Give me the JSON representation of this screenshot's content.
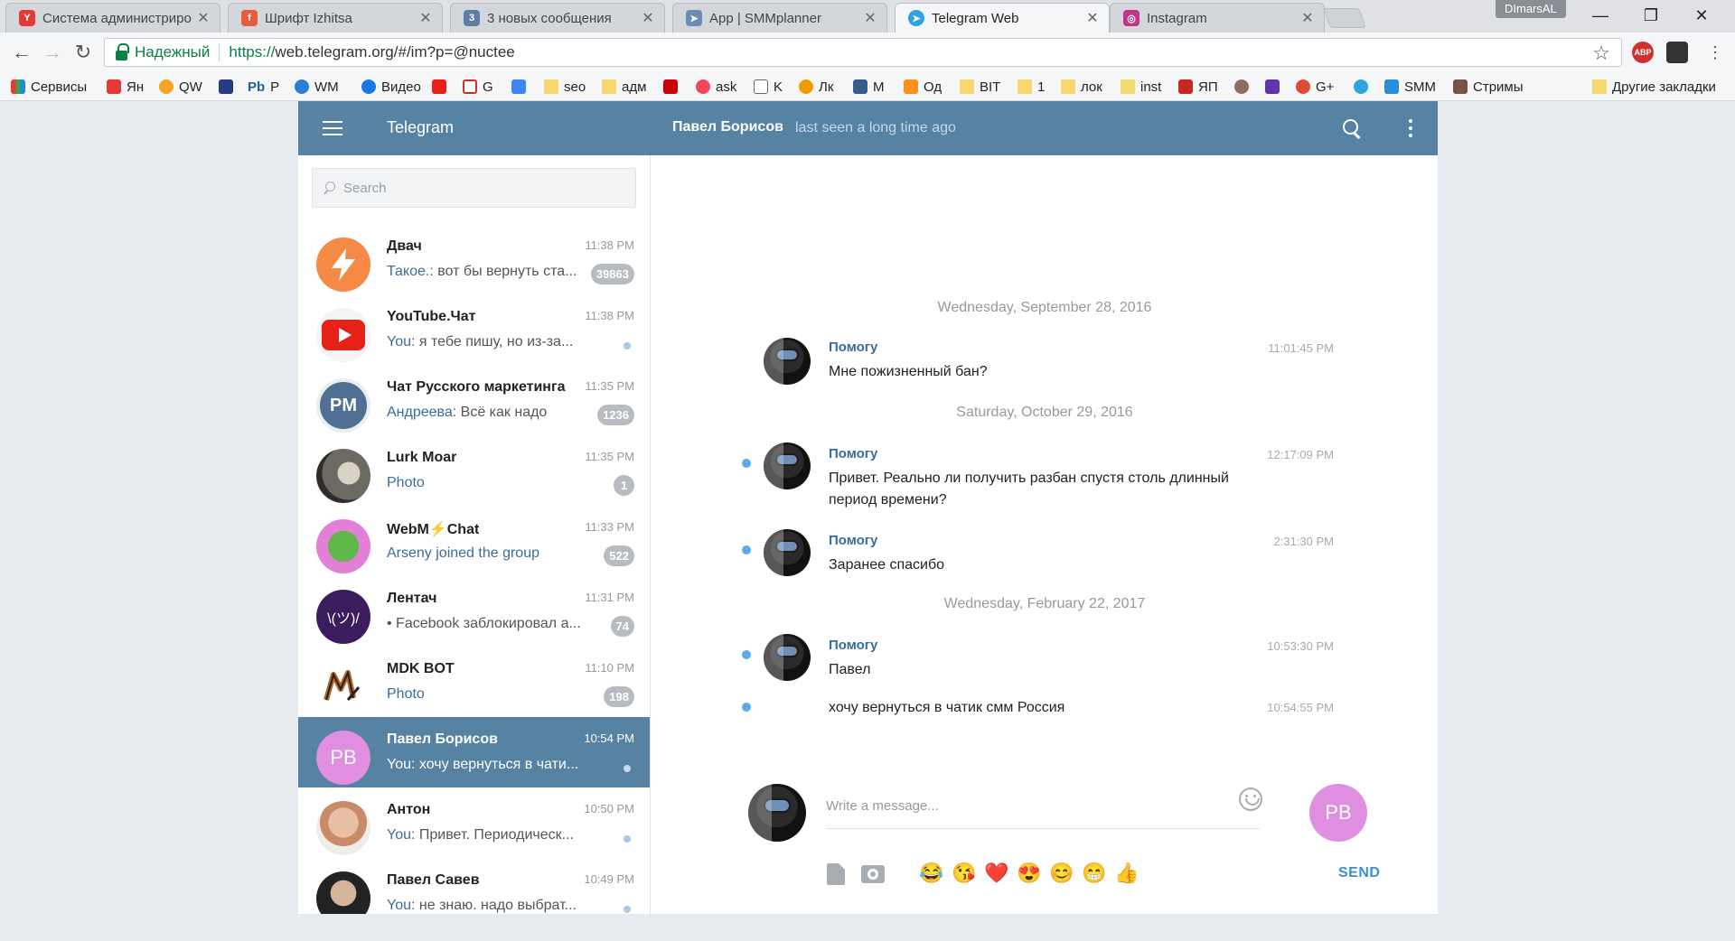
{
  "browser": {
    "tabs": [
      {
        "label": "Система администриро",
        "color": "#e53935"
      },
      {
        "label": "Шрифт Izhitsa",
        "color": "#ea5a3d"
      },
      {
        "label": "3 новых сообщения",
        "color": "#5b7fa6"
      },
      {
        "label": "App | SMMplanner",
        "color": "#6b8db5"
      },
      {
        "label": "Telegram Web",
        "color": "#2fa3e0"
      },
      {
        "label": "Instagram",
        "color": "#c13584"
      }
    ],
    "profile": "DImarsAL",
    "secure_label": "Надежный",
    "url_scheme": "https://",
    "url_rest": "web.telegram.org/#/im?p=@nuctee",
    "ext_abp": "ABP",
    "bookmarks": [
      "Сервисы",
      "Ян",
      "QW",
      "P",
      "WM",
      "Видео",
      "G",
      "seo",
      "адм",
      "ask",
      "K",
      "Лк",
      "M",
      "Од",
      "BIT",
      "1",
      "лок",
      "inst",
      "ЯП",
      "G+",
      "SMM",
      "Стримы",
      "Другие закладки"
    ],
    "bm_pb": "Pb"
  },
  "telegram": {
    "brand": "Telegram",
    "peer_name": "Павел Борисов",
    "peer_status": "last seen a long time ago",
    "search_placeholder": "Search",
    "dialogs": [
      {
        "name": "Двач",
        "time": "11:38 PM",
        "from": "Такое.:",
        "text": " вот бы вернуть ста...",
        "badge": "39863"
      },
      {
        "name": "YouTube.Чат",
        "time": "11:38 PM",
        "from": "You:",
        "text": " я тебе пишу, но из-за..."
      },
      {
        "name": "Чат Русского маркетинга",
        "time": "11:35 PM",
        "from": "Андреева:",
        "text": " Всё как надо",
        "badge": "1236",
        "initials": "PM"
      },
      {
        "name": "Lurk Moar",
        "time": "11:35 PM",
        "text": "Photo",
        "badge": "1"
      },
      {
        "name": "WebM⚡Chat",
        "time": "11:33 PM",
        "text": "Arseny joined the group",
        "badge": "522"
      },
      {
        "name": "Лентач",
        "time": "11:31 PM",
        "text": "• Facebook заблокировал а...",
        "badge": "74",
        "initials": "\\(ツ)/"
      },
      {
        "name": "MDK BOT",
        "time": "11:10 PM",
        "text": "Photo",
        "badge": "198"
      },
      {
        "name": "Павел Борисов",
        "time": "10:54 PM",
        "from": "You:",
        "text": " хочу вернуться в чати...",
        "initials": "PB"
      },
      {
        "name": "Антон",
        "time": "10:50 PM",
        "from": "You:",
        "text": " Привет. Периодическ..."
      },
      {
        "name": "Павел Савев",
        "time": "10:49 PM",
        "from": "You:",
        "text": " не знаю. надо выбрат..."
      }
    ],
    "history": {
      "dates": [
        "Wednesday, September 28, 2016",
        "Saturday, October 29, 2016",
        "Wednesday, February 22, 2017"
      ],
      "messages": [
        {
          "author": "Помогу",
          "text": "Мне пожизненный бан?",
          "time": "11:01:45 PM"
        },
        {
          "author": "Помогу",
          "text": "Привет. Реально ли получить разбан спустя столь длинный период времени?",
          "time": "12:17:09 PM"
        },
        {
          "author": "Помогу",
          "text": "Заранее спасибо",
          "time": "2:31:30 PM"
        },
        {
          "author": "Помогу",
          "text": "Павел",
          "time": "10:53:30 PM"
        },
        {
          "text": "хочу вернуться в чатик смм Россия",
          "time": "10:54:55 PM"
        }
      ]
    },
    "composer": {
      "placeholder": "Write a message...",
      "send_label": "SEND",
      "peer_initials": "PB",
      "quick_emoji": [
        "😂",
        "😘",
        "❤️",
        "😍",
        "😊",
        "😁",
        "👍"
      ]
    }
  }
}
